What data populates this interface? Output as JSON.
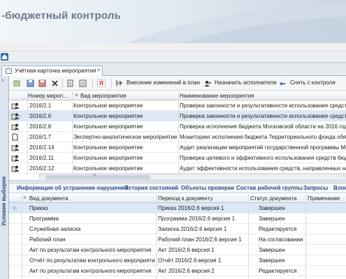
{
  "app": {
    "title": "-бюджетный контроль"
  },
  "tab": {
    "label": "Учётная карточка мероприятия",
    "close": "×"
  },
  "side": {
    "label": "Условия выборки",
    "arrow": "»"
  },
  "toolbar": {
    "amend_label": "Внесение изменений в план",
    "assign_label": "Назначить исполнителя",
    "withdraw_label": "Снять с контроля",
    "ya_label": "Я"
  },
  "events_grid": {
    "columns": [
      "Номер мероп...",
      "Вид мероприятия",
      "Наименование мероприятия"
    ],
    "rows": [
      {
        "number": "2016/2.1",
        "type": "Контрольное мероприятие",
        "name": "Проверка законности и результативности использования средств",
        "icon": "people-icon",
        "selected": false
      },
      {
        "number": "2016/2.6",
        "type": "Контрольное мероприятие",
        "name": "Проверка законности и результативности использования средств",
        "icon": "people-icon",
        "selected": true
      },
      {
        "number": "2016/2.8",
        "type": "Контрольное мероприятие",
        "name": "Проверка исполнения бюджета Московской области на 2016 год и",
        "icon": "people-icon",
        "selected": false
      },
      {
        "number": "2016/1.7",
        "type": "Экспертно-аналитическое мероприятие",
        "name": "Мониторинг исполнения бюджета Территориального фонда обяза",
        "icon": "document-icon",
        "selected": false
      },
      {
        "number": "2016/2.14",
        "type": "Контрольное мероприятие",
        "name": "Аудит реализации мероприятий государственной программы Моск",
        "icon": "people-icon",
        "selected": false
      },
      {
        "number": "2016/2.11",
        "type": "Контрольное мероприятие",
        "name": "Проверка целевого и эффективного использования средств бюдж",
        "icon": "people-icon",
        "selected": false
      },
      {
        "number": "2016/2.12",
        "type": "Контрольное мероприятие",
        "name": "Аудит эффективности использования средств, направленных на ст",
        "icon": "people-icon",
        "selected": false
      }
    ],
    "scroll_arrow_left": "‹",
    "scroll_arrow_right": "›",
    "scroll_grip": "III"
  },
  "detail_tabs": [
    "Информация об устранении нарушений",
    "История состояний",
    "Объекты проверки",
    "Состав рабочей группы",
    "Запросы",
    "Влож"
  ],
  "docs_grid": {
    "columns": [
      "Вид документа",
      "Переход к документу",
      "Статус документа",
      "Примечание"
    ],
    "rows": [
      {
        "kind": "Приказ",
        "link": "Приказ 2016/2.6 версия 1",
        "status": "Завершен",
        "note": "",
        "selected": true
      },
      {
        "kind": "Программа",
        "link": "Программа 2016/2.6 версия 1",
        "status": "Завершен",
        "note": "",
        "selected": false
      },
      {
        "kind": "Служебная записка",
        "link": "Записка 2016/2.6 версия 1",
        "status": "Редактируется",
        "note": "",
        "selected": false
      },
      {
        "kind": "Рабочий план",
        "link": "Рабочий план 2016/2.6 версия 1",
        "status": "На согласовании",
        "note": "",
        "selected": false
      },
      {
        "kind": "Акт по результатам контрольного мероприятия",
        "link": "Акт 2016/2.6 версия 1",
        "status": "Завершен",
        "note": "",
        "selected": false
      },
      {
        "kind": "Отчёт по результатам контрольного мероприятия",
        "link": "Отчёт 2016/2.6 версия 1",
        "status": "Завершен",
        "note": "",
        "selected": false
      },
      {
        "kind": "Акт по результатам контрольного мероприятия",
        "link": "Акт 2016/2.6 версия 2",
        "status": "Редактируется",
        "note": "",
        "selected": false
      }
    ]
  },
  "colors": {
    "selection": "#dce8f5",
    "accent": "#254f86",
    "title": "#6a7a8c"
  }
}
